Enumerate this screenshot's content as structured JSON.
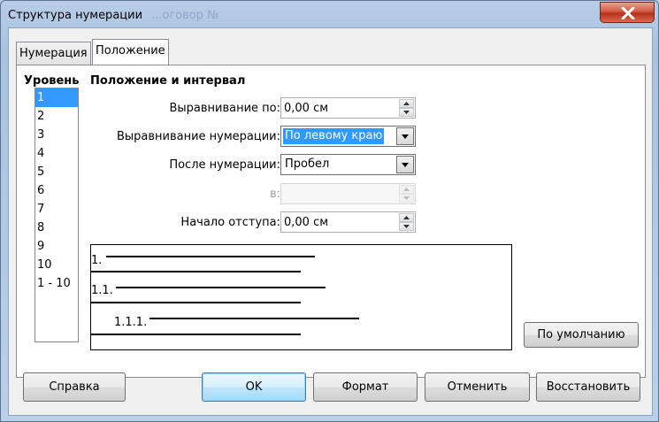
{
  "window": {
    "title": "Структура нумерации",
    "background_title": "...оговор №"
  },
  "tabs": [
    {
      "label": "Нумерация",
      "active": false
    },
    {
      "label": "Положение",
      "active": true
    }
  ],
  "levels": {
    "header": "Уровень",
    "items": [
      "1",
      "2",
      "3",
      "4",
      "5",
      "6",
      "7",
      "8",
      "9",
      "10",
      "1 - 10"
    ],
    "selected": "1"
  },
  "position": {
    "section_title": "Положение и интервал",
    "alignment_label": "Выравнивание по:",
    "alignment_value": "0,00 см",
    "numbering_alignment_label": "Выравнивание нумерации:",
    "numbering_alignment_value": "По левому краю",
    "after_numbering_label": "После нумерации:",
    "after_numbering_value": "Пробел",
    "at_label": "в:",
    "at_value": "",
    "indent_label": "Начало отступа:",
    "indent_value": "0,00 см"
  },
  "preview": {
    "num1": "1.",
    "num2": "1.1.",
    "num3": "1.1.1."
  },
  "buttons": {
    "default": "По умолчанию",
    "help": "Справка",
    "ok": "OK",
    "format": "Формат",
    "cancel": "Отменить",
    "restore": "Восстановить"
  },
  "colors": {
    "selection": "#3399ff",
    "close_button": "#c7402a"
  }
}
